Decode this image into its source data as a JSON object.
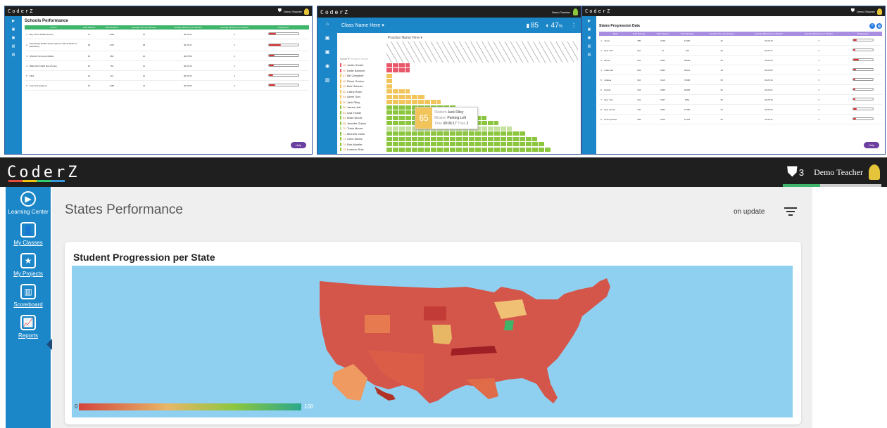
{
  "brand": "CoderZ",
  "colors": {
    "sidebar": "#1b87c9",
    "topbar": "#1f1f1f",
    "map_bg": "#8fd0f0",
    "green_header": "#3fb56b",
    "purple_header": "#a98de0"
  },
  "panel1": {
    "title": "Schools Performance",
    "headers": [
      "School",
      "Total Classes",
      "Total Students",
      "Average Time per Student",
      "Average Missions per Student",
      "Average Missions per Student",
      "Progression"
    ],
    "rows": [
      {
        "num": "1",
        "name": "Bay Shore Middle School",
        "c1": "17",
        "c2": "1963",
        "c3": "12",
        "c4": "00:26:32",
        "c5": "3",
        "progress": 0.25
      },
      {
        "num": "2",
        "name": "Piscataway Middle School (Mount Carmel Board of Education)",
        "c1": "48",
        "c2": "1370",
        "c3": "38",
        "c4": "00:26:47",
        "c5": "3",
        "progress": 0.42
      },
      {
        "num": "3",
        "name": "DMGNS Oil Group Middle",
        "c1": "46",
        "c2": "960",
        "c3": "10",
        "c4": "00:25:58",
        "c5": "3",
        "progress": 0.2
      },
      {
        "num": "4",
        "name": "BRETHIS STEM Mgt Primary",
        "c1": "25",
        "c2": "760",
        "c3": "11",
        "c4": "00:25:15",
        "c5": "3",
        "progress": 0.18
      },
      {
        "num": "5",
        "name": "SMS",
        "c1": "23",
        "c2": "421",
        "c3": "10",
        "c4": "00:26:23",
        "c5": "3",
        "progress": 0.15
      },
      {
        "num": "6",
        "name": "Cole N B Academy",
        "c1": "15",
        "c2": "1286",
        "c3": "14",
        "c4": "00:26:56",
        "c5": "3",
        "progress": 0.22
      }
    ],
    "user": "Demo Teacher",
    "help": "Help"
  },
  "panel2": {
    "class_select": "Class Name Here",
    "points": "85",
    "progress_pct": "47",
    "practice_select": "Practice Name Here",
    "score_label": "Score",
    "student_label": "Student Name",
    "students": [
      {
        "score": "10",
        "name": "Justin Hunter",
        "c": "#e8586a",
        "w": 0.12
      },
      {
        "score": "20",
        "name": "Kellie Bennett",
        "c": "#e8586a",
        "w": 0.12
      },
      {
        "score": "47",
        "name": "Bill Campbell",
        "c": "#f2c55c",
        "w": 0.03
      },
      {
        "score": "48",
        "name": "Ricori Gorkov",
        "c": "#f2c55c",
        "w": 0.03
      },
      {
        "score": "49",
        "name": "Bob Roberts",
        "c": "#f2c55c",
        "w": 0.03
      },
      {
        "score": "50",
        "name": "Cathy Rush",
        "c": "#f2c55c",
        "w": 0.12
      },
      {
        "score": "54",
        "name": "Alene Gen",
        "c": "#f2c55c",
        "w": 0.2
      },
      {
        "score": "55",
        "name": "Jack Riley",
        "c": "#f2c55c",
        "w": 0.28
      },
      {
        "score": "58",
        "name": "James Jett",
        "c": "#8cc63f",
        "w": 0.36
      },
      {
        "score": "63",
        "name": "Lisa Fowler",
        "c": "#8cc63f",
        "w": 0.44
      },
      {
        "score": "64",
        "name": "Brian Nicole",
        "c": "#8cc63f",
        "w": 0.52
      },
      {
        "score": "66",
        "name": "Jennifer Grison",
        "c": "#8cc63f",
        "w": 0.58
      },
      {
        "score": "70",
        "name": "Trista Moore",
        "c": "#c6e0a0",
        "w": 0.65
      },
      {
        "score": "71",
        "name": "Michelle Clark",
        "c": "#8cc63f",
        "w": 0.72
      },
      {
        "score": "73",
        "name": "Chris Steele",
        "c": "#8cc63f",
        "w": 0.78
      },
      {
        "score": "74",
        "name": "Rob Mueller",
        "c": "#8cc63f",
        "w": 0.82
      },
      {
        "score": "75",
        "name": "Lorenzo Ruiz",
        "c": "#8cc63f",
        "w": 0.85
      }
    ],
    "tooltip": {
      "score": "65",
      "student_label": "Student",
      "student": "Jack Riley",
      "mission_label": "Mission",
      "mission": "Parking Left",
      "time_label": "Time",
      "time": "00:06:17",
      "tries_label": "Tries",
      "tries": "2"
    },
    "user": "Demo Teacher"
  },
  "panel3": {
    "title": "States Progression Data",
    "headers": [
      "State",
      "Total Schools",
      "Total Classes",
      "Total Students",
      "Average Time per Student",
      "Average Missions per Student",
      "Average Missions per Student",
      "Progression"
    ],
    "rows": [
      {
        "num": "1",
        "name": "Texas",
        "c1": "385",
        "c2": "3738",
        "c3": "12900",
        "c4": "42",
        "c5": "00:26:15",
        "c6": "3",
        "progress": 0.2
      },
      {
        "num": "2",
        "name": "New York",
        "c1": "261",
        "c2": "47",
        "c3": "149",
        "c4": "40",
        "c5": "00:26:17",
        "c6": "3",
        "progress": 0.12
      },
      {
        "num": "3",
        "name": "Illinois",
        "c1": "310",
        "c2": "3950",
        "c3": "35035",
        "c4": "39",
        "c5": "00:26:32",
        "c6": "3",
        "progress": 0.3
      },
      {
        "num": "4",
        "name": "California",
        "c1": "863",
        "c2": "6832",
        "c3": "32031",
        "c4": "39",
        "c5": "00:26:05",
        "c6": "3",
        "progress": 0.15
      },
      {
        "num": "5",
        "name": "Indiana",
        "c1": "316",
        "c2": "3116",
        "c3": "74036",
        "c4": "35",
        "c5": "00:26:13",
        "c6": "3",
        "progress": 0.12
      },
      {
        "num": "6",
        "name": "Florida",
        "c1": "343",
        "c2": "2955",
        "c3": "20345",
        "c4": "30",
        "c5": "00:26:01",
        "c6": "3",
        "progress": 0.12
      },
      {
        "num": "7",
        "name": "New York",
        "c1": "244",
        "c2": "3327",
        "c3": "3281",
        "c4": "35",
        "c5": "00:26:35",
        "c6": "3",
        "progress": 0.12
      },
      {
        "num": "8",
        "name": "New Jersey",
        "c1": "165",
        "c2": "3833",
        "c3": "12366",
        "c4": "34",
        "c5": "00:26:23",
        "c6": "3",
        "progress": 0.2
      },
      {
        "num": "9",
        "name": "Pennsylvania",
        "c1": "268",
        "c2": "2016",
        "c3": "14323",
        "c4": "36",
        "c5": "00:26:11",
        "c6": "3",
        "progress": 0.15
      }
    ],
    "user": "Demo Teacher",
    "help": "Help"
  },
  "main": {
    "shield_count": "3",
    "user": "Demo Teacher",
    "page_title": "States Performance",
    "sort_label": "on update",
    "card_title": "Student Progression per State",
    "legend_min": "0",
    "legend_max": "100",
    "sidebar": [
      {
        "label": "Learning Center",
        "icon": "play-circle-icon",
        "glyph": "▶"
      },
      {
        "label": "My Classes",
        "icon": "classes-icon",
        "glyph": "👤"
      },
      {
        "label": "My Projects",
        "icon": "projects-folder-icon",
        "glyph": "★"
      },
      {
        "label": "Scoreboard",
        "icon": "scoreboard-icon",
        "glyph": "▥"
      },
      {
        "label": "Reports",
        "icon": "reports-chart-icon",
        "glyph": "📈"
      }
    ]
  }
}
